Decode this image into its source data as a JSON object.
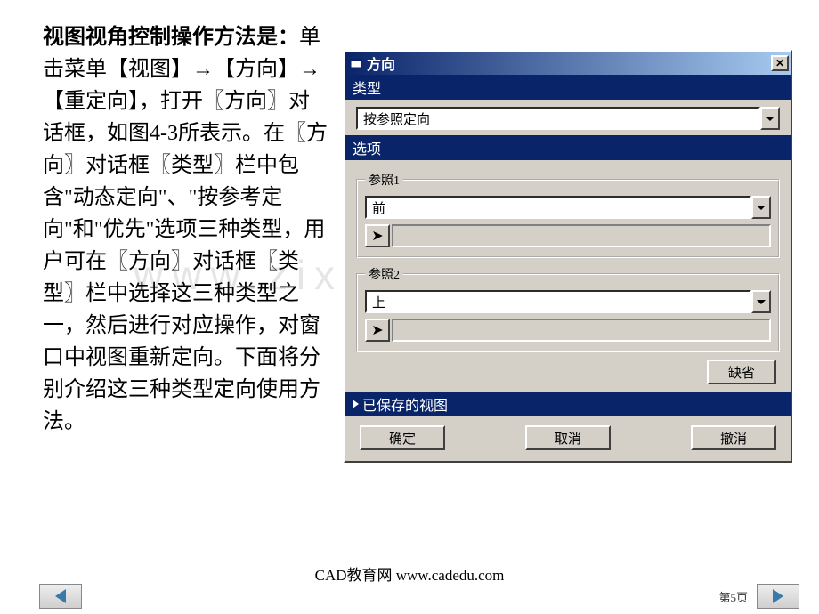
{
  "text": {
    "title": "视图视角控制操作方法是：",
    "body": "单击菜单【视图】→【方向】→【重定向】，打开〖方向〗对话框，如图4-3所表示。在〖方向〗对话框〖类型〗栏中包含\"动态定向\"、\"按参考定向\"和\"优先\"选项三种类型，用户可在〖方向〗对话框〖类型〗栏中选择这三种类型之一，然后进行对应操作，对窗口中视图重新定向。下面将分别介绍这三种类型定向使用方法。"
  },
  "dialog": {
    "title": "方向",
    "type_label": "类型",
    "type_value": "按参照定向",
    "options_label": "选项",
    "ref1_label": "参照1",
    "ref1_value": "前",
    "ref2_label": "参照2",
    "ref2_value": "上",
    "default_btn": "缺省",
    "saved_label": "已保存的视图",
    "ok": "确定",
    "cancel": "取消",
    "undo": "撤消"
  },
  "footer": {
    "credit": "CAD教育网 www.cadedu.com",
    "page": "第5页"
  },
  "watermark": "www.zixin.com.cn"
}
